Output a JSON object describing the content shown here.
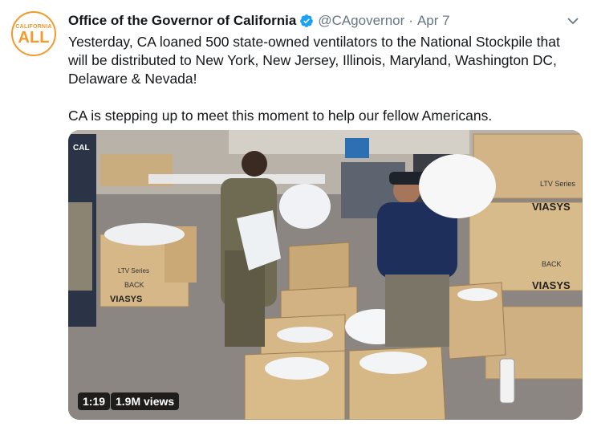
{
  "tweet": {
    "account_name": "Office of the Governor of California",
    "handle": "@CAgovernor",
    "separator": "·",
    "date": "Apr 7",
    "avatar": {
      "top_text": "CALIFORNIA",
      "main_text": "ALL",
      "color": "#f39a2b"
    },
    "verified_color": "#1da1f2",
    "paragraphs": [
      "Yesterday, CA loaned 500 state-owned ventilators to the National Stockpile that will be distributed to New York, New Jersey, Illinois, Maryland, Washington DC, Delaware & Nevada!",
      "CA is stepping up to meet this moment to help our fellow Americans."
    ],
    "video": {
      "duration": "1:19",
      "views": "1.9M views",
      "box_text": {
        "brand": "VIASYS",
        "model": "LTV Series",
        "back": "BACK",
        "shirt": "CAL"
      }
    }
  }
}
